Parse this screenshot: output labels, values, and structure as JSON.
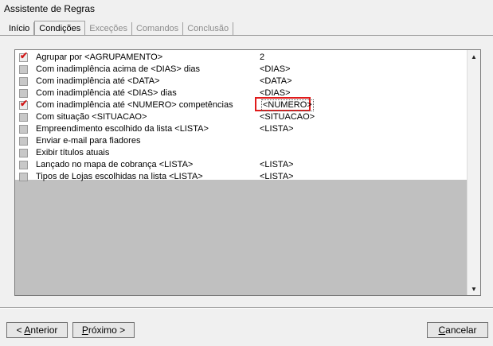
{
  "window": {
    "title": "Assistente de Regras"
  },
  "tabs": [
    {
      "label": "Início",
      "state": "normal"
    },
    {
      "label": "Condições",
      "state": "active"
    },
    {
      "label": "Exceções",
      "state": "disabled"
    },
    {
      "label": "Comandos",
      "state": "disabled"
    },
    {
      "label": "Conclusão",
      "state": "disabled"
    }
  ],
  "conditions": [
    {
      "label": "Agrupar por <AGRUPAMENTO>",
      "value": "2",
      "checked": true
    },
    {
      "label": "Com inadimplência acima de <DIAS> dias",
      "value": "<DIAS>",
      "checked": false
    },
    {
      "label": "Com inadimplência até <DATA>",
      "value": "<DATA>",
      "checked": false
    },
    {
      "label": "Com inadimplência até <DIAS>  dias",
      "value": "<DIAS>",
      "checked": false
    },
    {
      "label": "Com inadimplência até <NUMERO> competências",
      "value": "<NUMERO>",
      "checked": true,
      "highlighted": true
    },
    {
      "label": "Com situação <SITUACAO>",
      "value": "<SITUACAO>",
      "checked": false
    },
    {
      "label": "Empreendimento escolhido da lista <LISTA>",
      "value": "<LISTA>",
      "checked": false
    },
    {
      "label": "Enviar e-mail para fiadores",
      "value": "",
      "checked": false
    },
    {
      "label": "Exibir títulos atuais",
      "value": "",
      "checked": false
    },
    {
      "label": "Lançado no mapa de cobrança <LISTA>",
      "value": "<LISTA>",
      "checked": false
    },
    {
      "label": "Tipos de Lojas escolhidas na lista <LISTA>",
      "value": "<LISTA>",
      "checked": false
    }
  ],
  "buttons": {
    "previous": {
      "label_pre": "< ",
      "label_hot": "A",
      "label_post": "nterior"
    },
    "next": {
      "label_pre": "",
      "label_hot": "P",
      "label_post": "róximo >"
    },
    "cancel": {
      "label_pre": "",
      "label_hot": "C",
      "label_post": "ancelar"
    }
  },
  "colors": {
    "highlight_border": "#e01b1b",
    "check_mark": "#d21a1a",
    "empty_area": "#c0c0c0"
  }
}
